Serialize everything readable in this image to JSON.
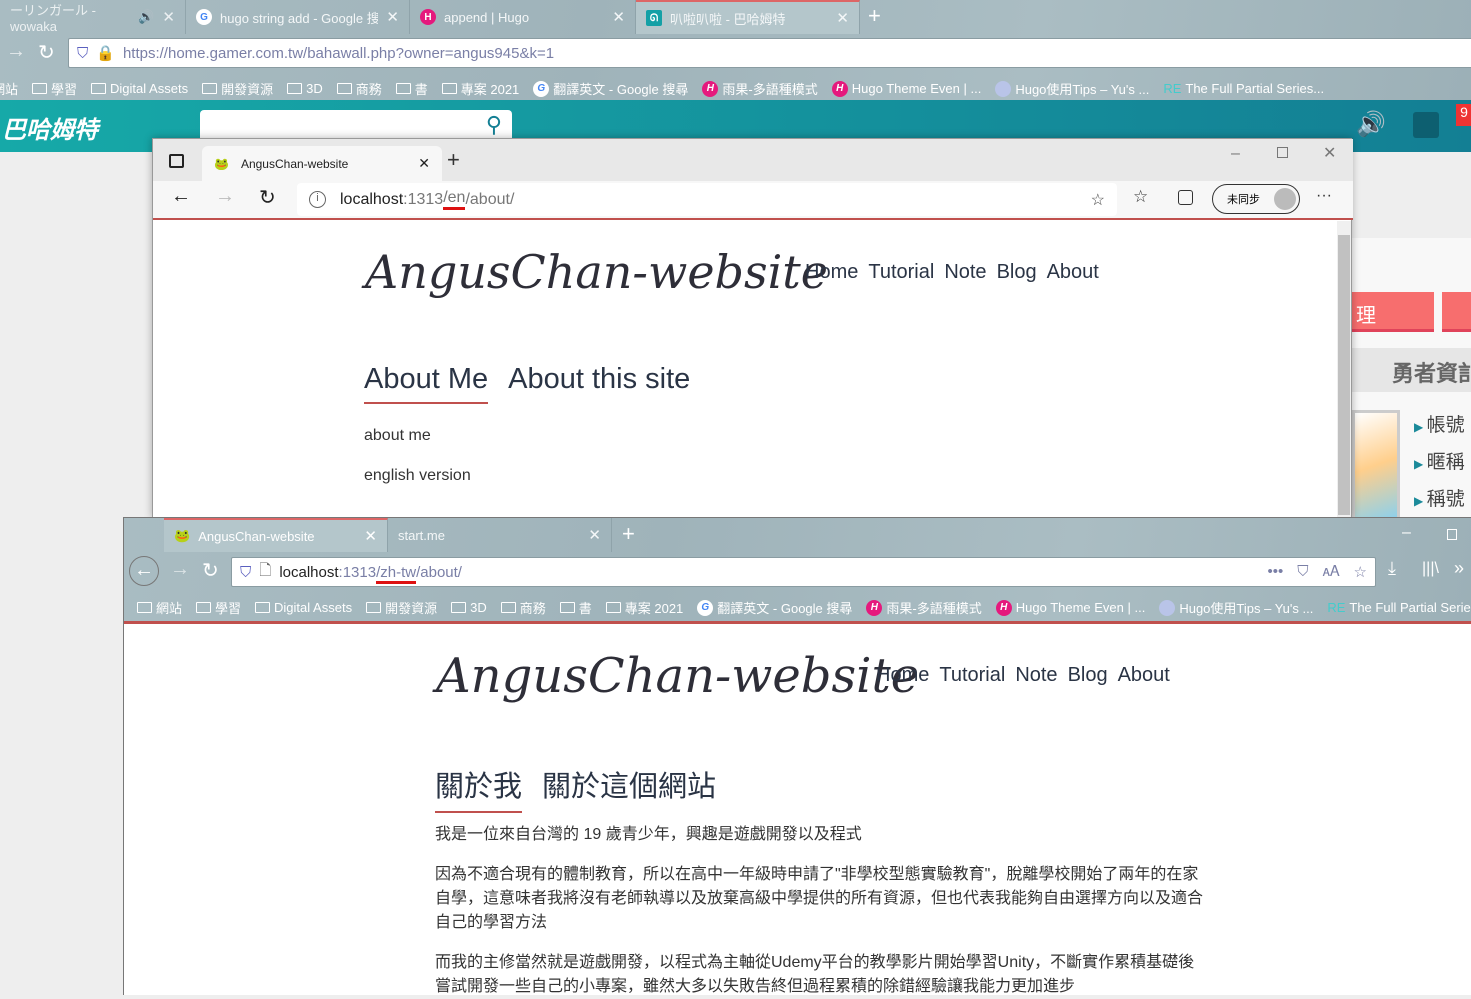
{
  "back_browser": {
    "tabs": [
      {
        "label": "ーリンガール - wowaka",
        "icon": "speaker-icon"
      },
      {
        "label": "hugo string add - Google 搜尋",
        "icon": "google-icon"
      },
      {
        "label": "append | Hugo",
        "icon": "hugo-icon"
      },
      {
        "label": "叭啦叭啦 - 巴哈姆特",
        "icon": "bahamut-icon"
      }
    ],
    "url": "https://home.gamer.com.tw/bahawall.php?owner=angus945&k=1",
    "url_host": "home.gamer.com.tw",
    "bookmarks": [
      "網站",
      "學習",
      "Digital Assets",
      "開發資源",
      "3D",
      "商務",
      "書",
      "專案 2021",
      "翻譯英文 - Google 搜尋",
      "雨果-多語種模式",
      "Hugo Theme Even | ...",
      "Hugo使用Tips – Yu's ...",
      "The Full Partial Series..."
    ],
    "site": {
      "logo": "巴哈姆特",
      "badge": "9",
      "button_partial": "理",
      "section_title": "勇者資訁",
      "fields": [
        "帳號",
        "暱稱",
        "稱號"
      ]
    }
  },
  "edge": {
    "tab_label": "AngusChan-website",
    "url_host": "localhost",
    "url_port": ":1313",
    "url_lang": "/en",
    "url_path": "/about/",
    "sync_label": "未同步",
    "page": {
      "logo": "AngusChan-website",
      "menu": [
        "Home",
        "Tutorial",
        "Note",
        "Blog",
        "About"
      ],
      "tabs": [
        "About Me",
        "About this site"
      ],
      "paragraphs": [
        "about me",
        "english version"
      ]
    }
  },
  "firefox": {
    "tabs": [
      "AngusChan-website",
      "start.me"
    ],
    "url_host": "localhost",
    "url_port": ":1313",
    "url_lang": "/zh-tw",
    "url_path": "/about/",
    "bookmarks": [
      "網站",
      "學習",
      "Digital Assets",
      "開發資源",
      "3D",
      "商務",
      "書",
      "專案 2021",
      "翻譯英文 - Google 搜尋",
      "雨果-多語種模式",
      "Hugo Theme Even | ...",
      "Hugo使用Tips – Yu's ...",
      "The Full Partial Series..."
    ],
    "page": {
      "logo": "AngusChan-website",
      "menu": [
        "Home",
        "Tutorial",
        "Note",
        "Blog",
        "About"
      ],
      "tabs": [
        "關於我",
        "關於這個網站"
      ],
      "paragraphs": [
        "我是一位來自台灣的 19 歲青少年，興趣是遊戲開發以及程式",
        "因為不適合現有的體制教育，所以在高中一年級時申請了\"非學校型態實驗教育\"，脫離學校開始了兩年的在家自學，這意味者我將沒有老師執導以及放棄高級中學提供的所有資源，但也代表我能夠自由選擇方向以及適合自己的學習方法",
        "而我的主修當然就是遊戲開發，以程式為主軸從Udemy平台的教學影片開始學習Unity，不斷實作累積基礎後嘗試開發一些自己的小專案，雖然大多以失敗告終但過程累積的除錯經驗讓我能力更加進步"
      ]
    }
  },
  "colors": {
    "accent": "#c0504d",
    "teal": "#14a0a6",
    "hugo": "#e5197d"
  }
}
